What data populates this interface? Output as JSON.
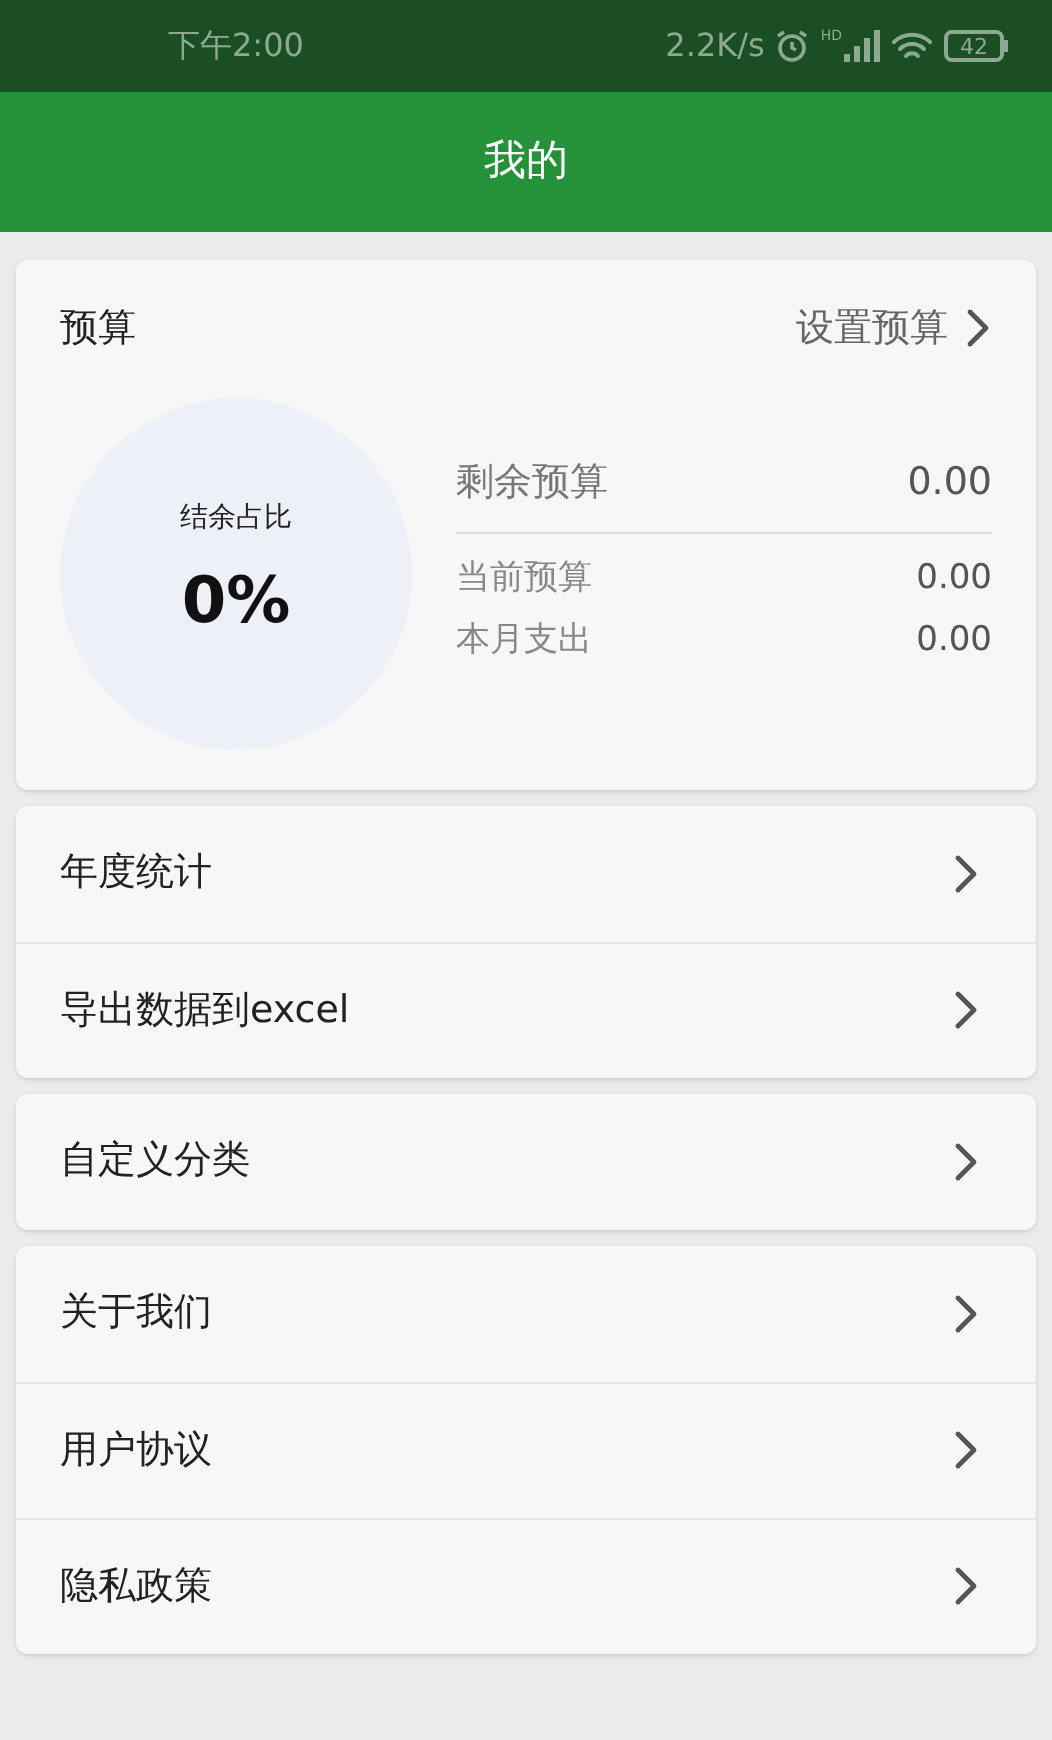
{
  "status_bar": {
    "time": "下午2:00",
    "speed": "2.2K/s",
    "signal_label": "HD",
    "battery": "42"
  },
  "header": {
    "title": "我的"
  },
  "budget": {
    "title": "预算",
    "action": "设置预算",
    "ratio_label": "结余占比",
    "ratio": "0%",
    "remaining": {
      "label": "剩余预算",
      "value": "0.00"
    },
    "rows": [
      {
        "label": "当前预算",
        "value": "0.00"
      },
      {
        "label": "本月支出",
        "value": "0.00"
      }
    ]
  },
  "menu_groups": [
    [
      {
        "label": "年度统计"
      },
      {
        "label": "导出数据到excel"
      }
    ],
    [
      {
        "label": "自定义分类"
      }
    ],
    [
      {
        "label": "关于我们"
      },
      {
        "label": "用户协议"
      },
      {
        "label": "隐私政策"
      }
    ]
  ]
}
